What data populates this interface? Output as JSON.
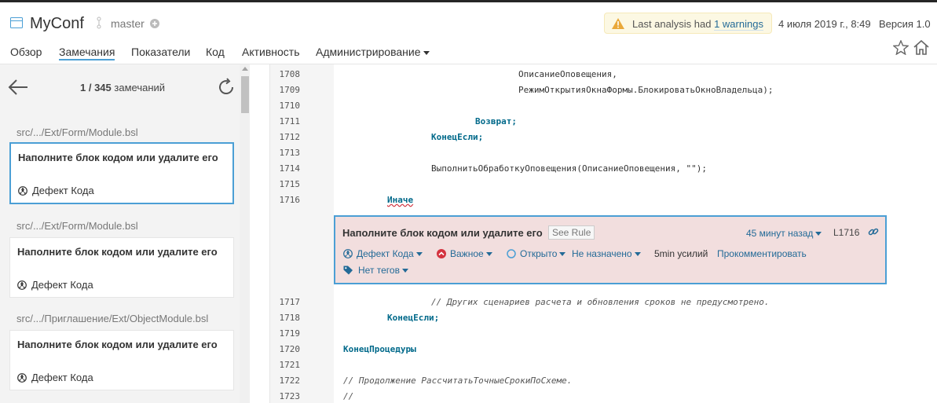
{
  "header": {
    "project": "MyConf",
    "branch": "master",
    "warning_prefix": "Last analysis had ",
    "warning_link": "1 warnings",
    "date": "4 июля 2019 г., 8:49",
    "version": "Версия 1.0"
  },
  "nav": {
    "items": [
      "Обзор",
      "Замечания",
      "Показатели",
      "Код",
      "Активность",
      "Администрирование"
    ],
    "active": "Замечания"
  },
  "sidebar": {
    "counter_value": "1 / 345",
    "counter_label": "замечаний",
    "issues": [
      {
        "path": "src/.../Ext/Form/Module.bsl",
        "title": "Наполните блок кодом или удалите его",
        "type": "Дефект Кода"
      },
      {
        "path": "src/.../Ext/Form/Module.bsl",
        "title": "Наполните блок кодом или удалите его",
        "type": "Дефект Кода"
      },
      {
        "path": "src/.../Приглашение/Ext/ObjectModule.bsl",
        "title": "Наполните блок кодом или удалите его",
        "type": "Дефект Кода"
      }
    ]
  },
  "code": {
    "lines_before": [
      {
        "n": "1708",
        "text": "ОписаниеОповещения,"
      },
      {
        "n": "1709",
        "text": "РежимОткрытияОкнаФормы.БлокироватьОкноВладельца);"
      },
      {
        "n": "1710",
        "text": ""
      },
      {
        "n": "1711",
        "text": "Возврат;"
      },
      {
        "n": "1712",
        "text": "КонецЕсли;"
      },
      {
        "n": "1713",
        "text": ""
      },
      {
        "n": "1714",
        "text": "ВыполнитьОбработкуОповещения(ОписаниеОповещения, \"\");"
      },
      {
        "n": "1715",
        "text": ""
      },
      {
        "n": "1716",
        "text": "Иначе"
      }
    ],
    "lines_after": [
      {
        "n": "1717",
        "text": "// Других сценариев расчета и обновления сроков не предусмотрено."
      },
      {
        "n": "1718",
        "text": "КонецЕсли;"
      },
      {
        "n": "1719",
        "text": ""
      },
      {
        "n": "1720",
        "text": "КонецПроцедуры"
      },
      {
        "n": "1721",
        "text": ""
      },
      {
        "n": "1722",
        "text": "// Продолжение РассчитатьТочныеСрокиПоСхеме."
      },
      {
        "n": "1723",
        "text": "//"
      }
    ]
  },
  "issue": {
    "title": "Наполните блок кодом или удалите его",
    "see_rule": "See Rule",
    "time": "45 минут назад",
    "line": "L1716",
    "type": "Дефект Кода",
    "severity": "Важное",
    "status": "Открыто",
    "assignee": "Не назначено",
    "effort": "5min усилий",
    "comment": "Прокомментировать",
    "tags": "Нет тегов"
  },
  "colors": {
    "accent": "#4b9fd5",
    "link": "#236a97",
    "issue_bg": "#f2dede",
    "warning_bg": "#fcf8e3",
    "severity_major": "#d4333f"
  }
}
